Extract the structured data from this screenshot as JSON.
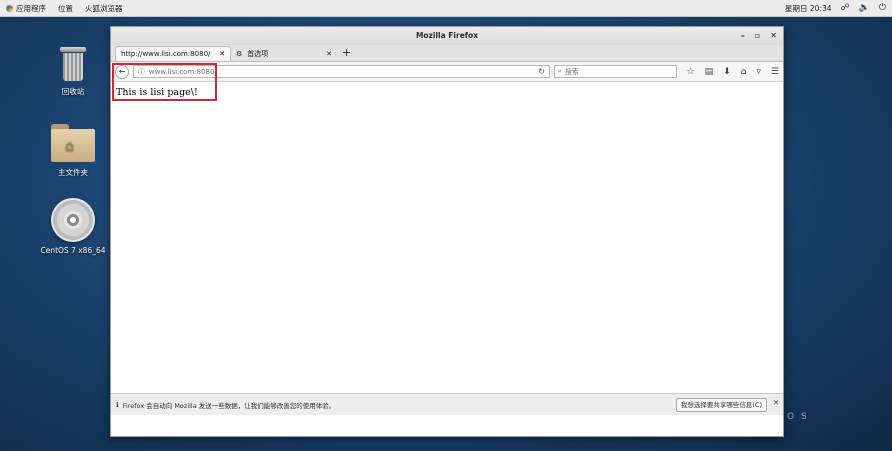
{
  "topbar": {
    "applications": "应用程序",
    "places": "位置",
    "firefox": "火狐浏览器",
    "clock": "星期日 20:34"
  },
  "desktop": {
    "trash_label": "回收站",
    "home_label": "主文件夹",
    "disc_label": "CentOS 7 x86_64"
  },
  "window": {
    "title": "Mozilla Firefox",
    "tabs": [
      {
        "label": "http://www.lisi.com:8080/"
      },
      {
        "label": "首选项"
      }
    ],
    "url": "www.lisi.com:8080",
    "search_placeholder": "搜索",
    "page_text": "This is lisi page\\!",
    "notification": {
      "text": "Firefox 会自动向 Mozilla 发送一些数据，让我们能够改善您的使用体验。",
      "button": "我想选择要共享哪些信息(C)"
    }
  },
  "watermark": "O S",
  "icons": {
    "apps": "apps-icon",
    "network": "network-icon",
    "volume": "volume-icon",
    "power": "power-icon",
    "back": "back-arrow-icon",
    "info": "info-icon",
    "reload": "reload-icon",
    "search": "magnifier-icon",
    "bookmark": "star-icon",
    "library": "library-icon",
    "download": "download-icon",
    "home": "home-icon",
    "pocket": "pocket-icon",
    "menu": "hamburger-menu-icon"
  },
  "colors": {
    "highlight": "#d9262e",
    "desktop_bg": "#1d4673"
  }
}
